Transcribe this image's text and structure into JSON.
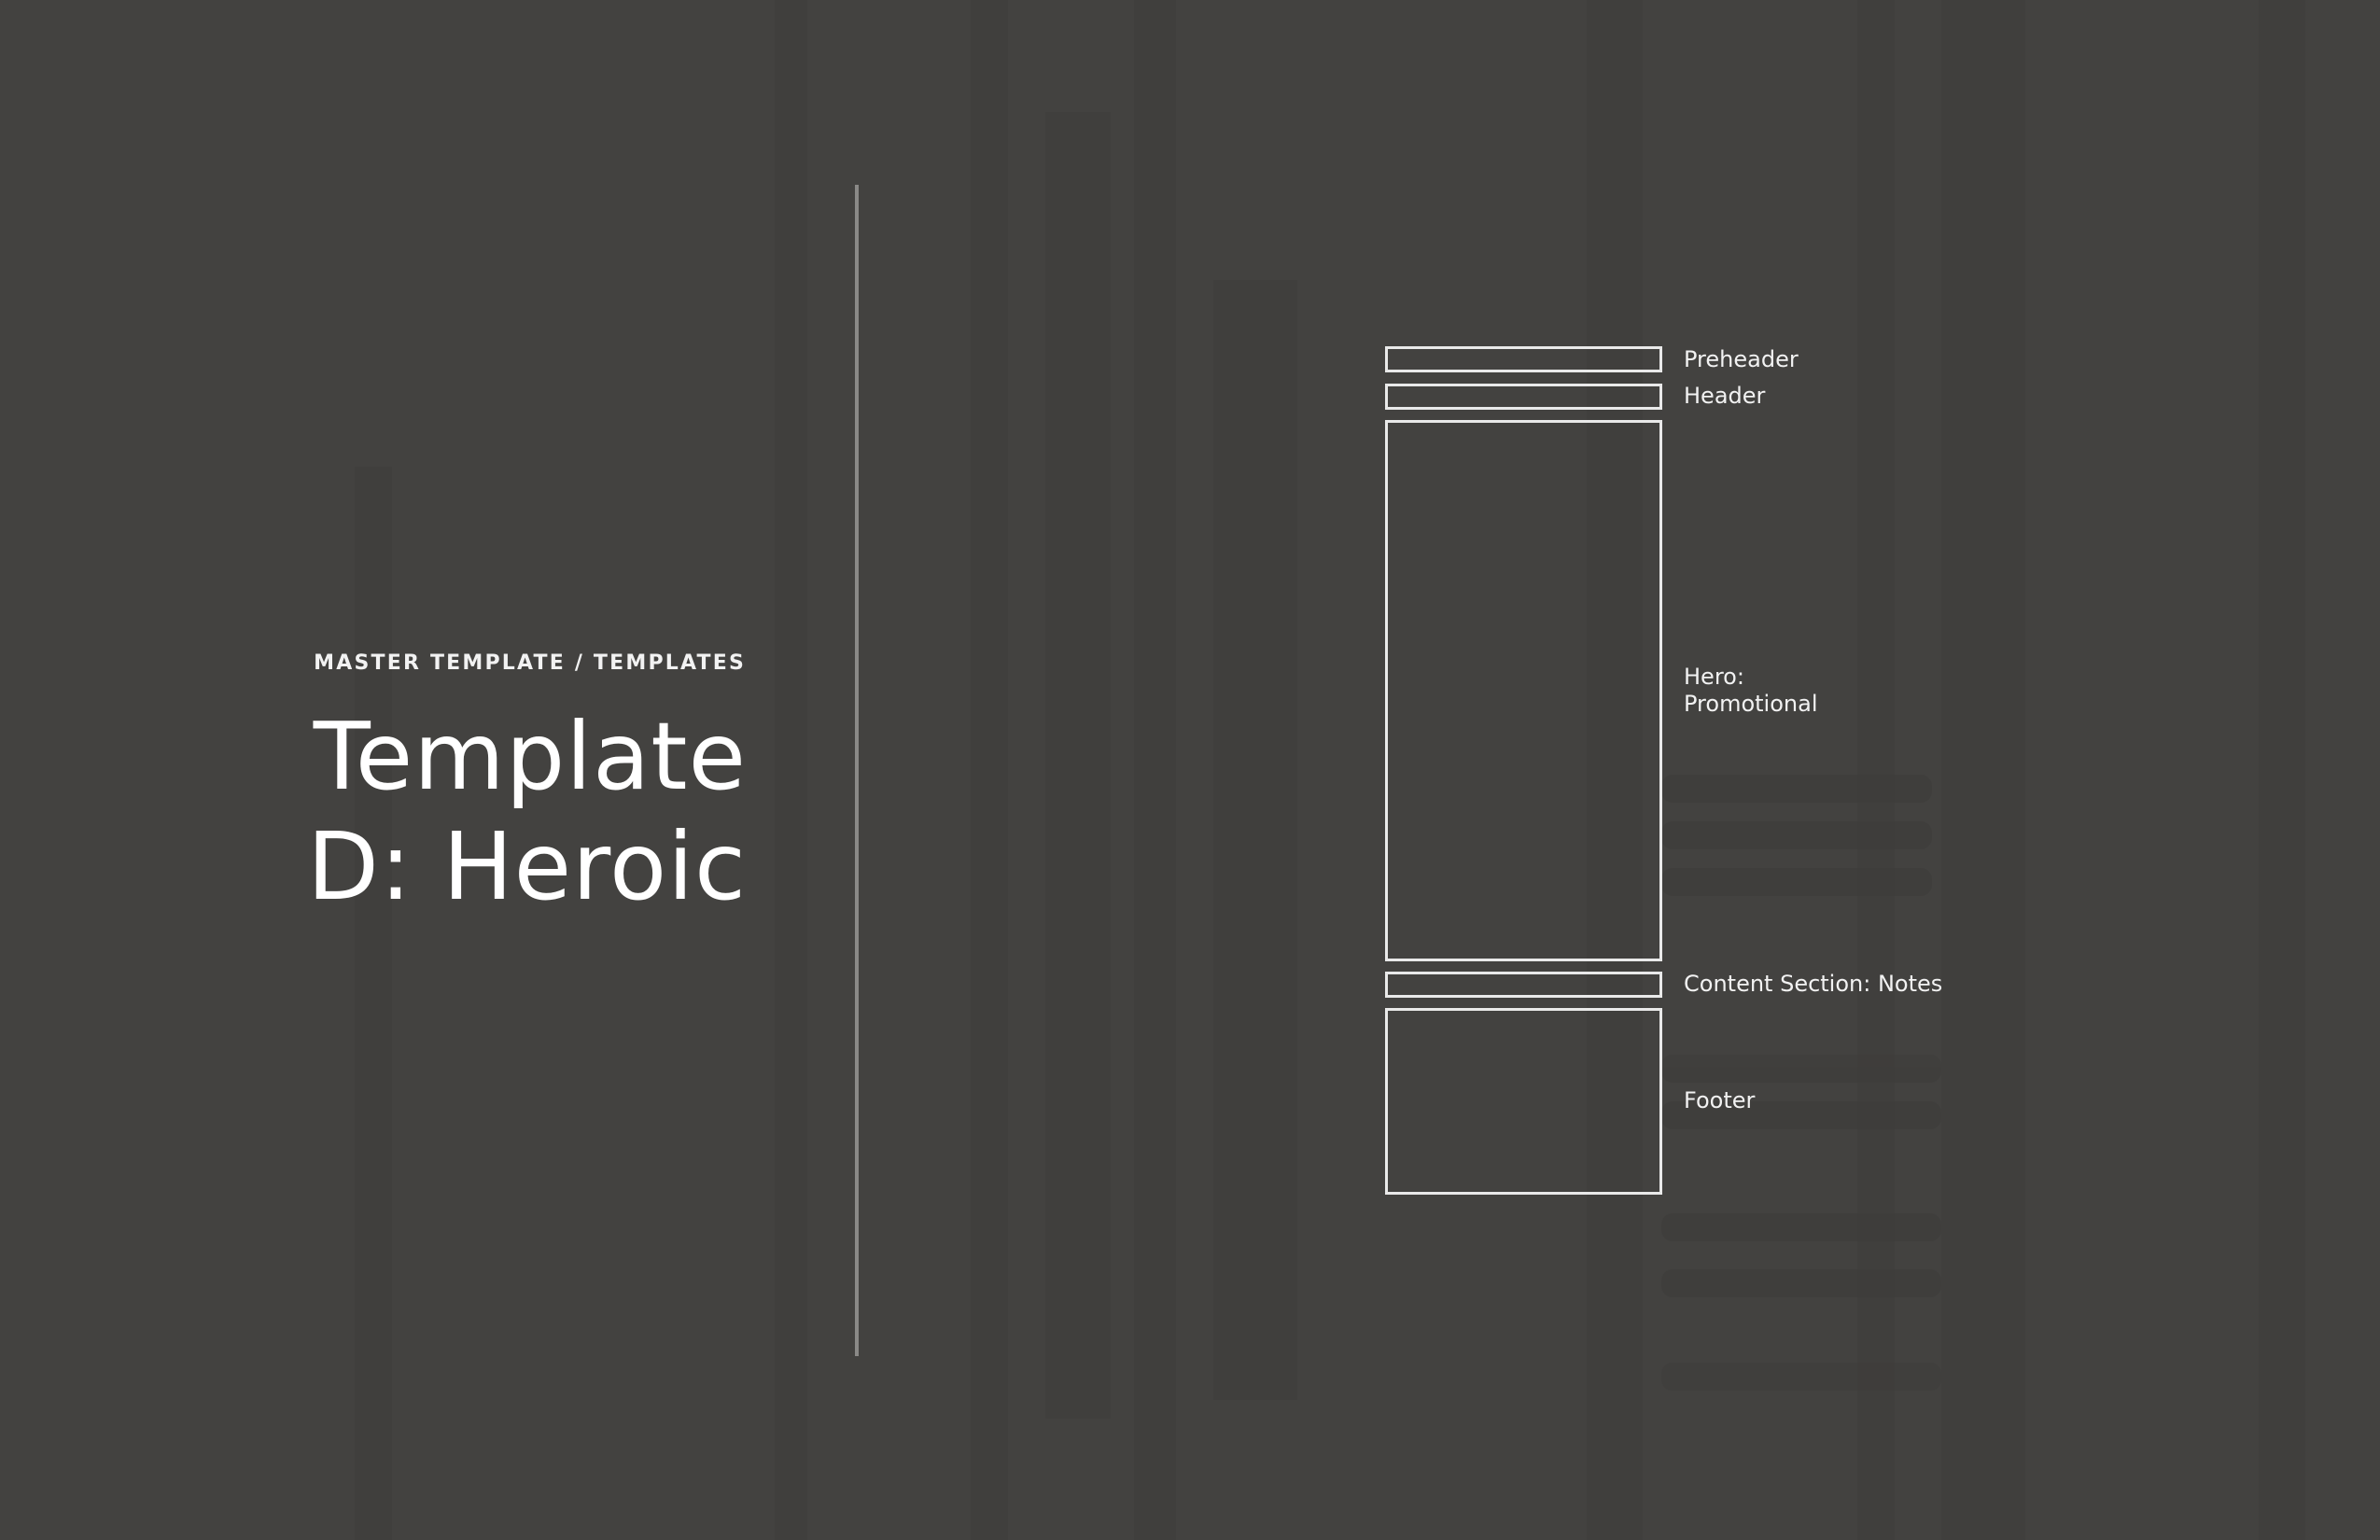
{
  "eyebrow": "MASTER TEMPLATE / TEMPLATES",
  "title": {
    "line1": "Template",
    "line2": "D: Heroic"
  },
  "layout_blocks": [
    {
      "id": "preheader",
      "label": "Preheader"
    },
    {
      "id": "header",
      "label": "Header"
    },
    {
      "id": "hero",
      "label": "Hero:\nPromotional"
    },
    {
      "id": "content",
      "label": "Content Section: Notes"
    },
    {
      "id": "footer",
      "label": "Footer"
    }
  ],
  "colors": {
    "background": "#434240",
    "divider": "#8a8987",
    "outline": "#e9e9e9",
    "text": "#ffffff"
  }
}
